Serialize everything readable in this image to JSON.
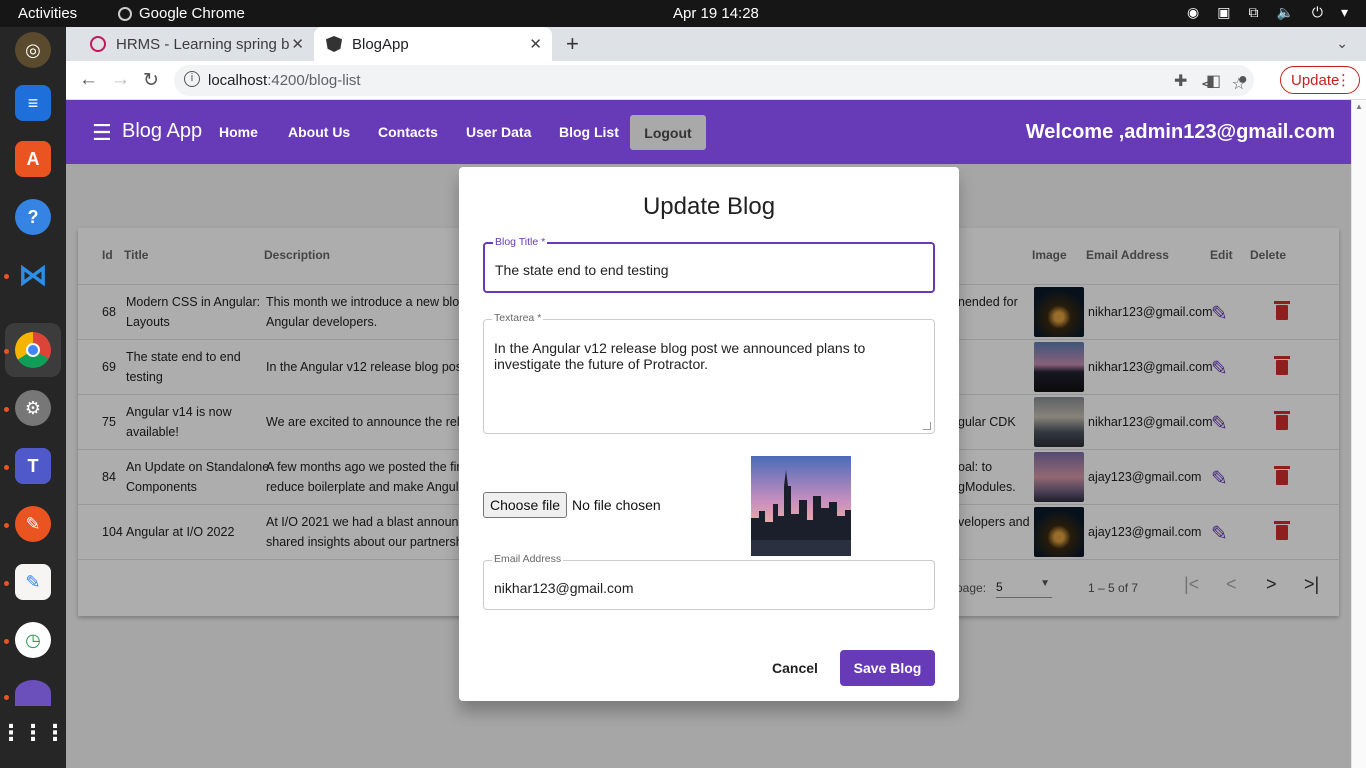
{
  "os": {
    "activities": "Activities",
    "app_name": "Google Chrome",
    "clock": "Apr 19  14:28"
  },
  "browser": {
    "tabs": [
      {
        "title": "HRMS - Learning spring b",
        "active": false
      },
      {
        "title": "BlogApp",
        "active": true
      }
    ],
    "url_host": "localhost",
    "url_path": ":4200/blog-list",
    "update_label": "Update"
  },
  "app": {
    "brand": "Blog App",
    "nav": [
      "Home",
      "About Us",
      "Contacts",
      "User Data",
      "Blog List"
    ],
    "logout": "Logout",
    "welcome": "Welcome ,admin123@gmail.com"
  },
  "table": {
    "headers": {
      "id": "Id",
      "title": "Title",
      "description": "Description",
      "image": "Image",
      "email": "Email Address",
      "edit": "Edit",
      "delete": "Delete"
    },
    "rows": [
      {
        "id": "68",
        "title1": "Modern CSS in Angular:",
        "title2": "Layouts",
        "desc1": "This month we introduce a new blog",
        "desc2": "Angular developers.",
        "tail1": "nended for",
        "tail2": "",
        "email": "nikhar123@gmail.com"
      },
      {
        "id": "69",
        "title1": "The state end to end",
        "title2": "testing",
        "desc1": "In the Angular v12 release blog post",
        "desc2": "",
        "tail1": "",
        "tail2": "",
        "email": "nikhar123@gmail.com"
      },
      {
        "id": "75",
        "title1": "Angular v14 is now",
        "title2": "available!",
        "desc1": "We are excited to announce the relea",
        "desc2": "",
        "tail1": "gular CDK",
        "tail2": "",
        "email": "nikhar123@gmail.com"
      },
      {
        "id": "84",
        "title1": "An Update on Standalone",
        "title2": "Components",
        "desc1": "A few months ago we posted the firs",
        "desc2": "reduce boilerplate and make Angular",
        "tail1": "oal: to",
        "tail2": "gModules.",
        "email": "ajay123@gmail.com"
      },
      {
        "id": "104",
        "title1": "Angular at I/O 2022",
        "title2": "",
        "desc1": "At I/O 2021 we had a blast announci",
        "desc2": "shared insights about our partnershi",
        "tail1": "velopers and",
        "tail2": "",
        "email": "ajay123@gmail.com"
      }
    ],
    "paginator": {
      "items_label": "page:",
      "page_size": "5",
      "range": "1 – 5 of 7"
    }
  },
  "dialog": {
    "title": "Update Blog",
    "blog_title_label": "Blog Title",
    "blog_title_value": "The state end to end testing",
    "textarea_label": "Textarea",
    "textarea_value": "In the Angular v12 release blog post we announced plans to investigate the future of Protractor.",
    "choose_file": "Choose file",
    "no_file": "No file chosen",
    "email_label": "Email Address",
    "email_value": "nikhar123@gmail.com",
    "cancel": "Cancel",
    "save": "Save Blog"
  },
  "colors": {
    "primary": "#673ab7",
    "warn": "#d32f2f"
  }
}
